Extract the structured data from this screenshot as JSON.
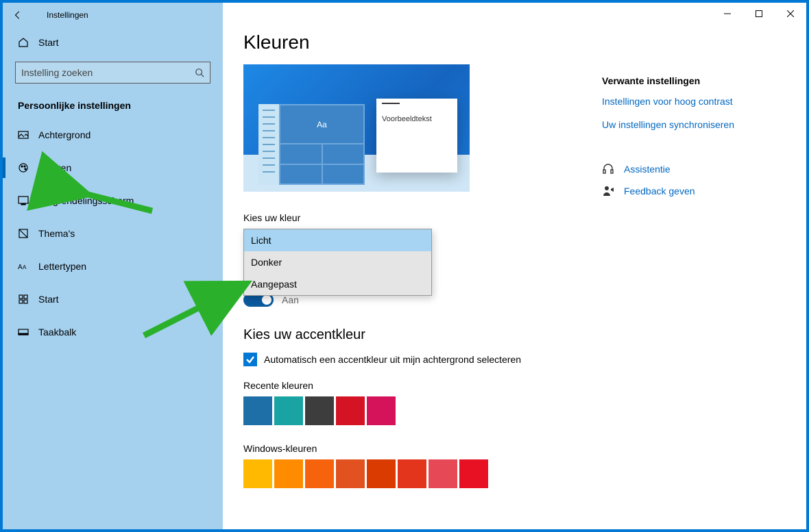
{
  "window": {
    "title": "Instellingen"
  },
  "home": {
    "label": "Start"
  },
  "search": {
    "placeholder": "Instelling zoeken"
  },
  "sidebar": {
    "section_title": "Persoonlijke instellingen",
    "items": [
      {
        "label": "Achtergrond"
      },
      {
        "label": "Kleuren"
      },
      {
        "label": "Vergrendelingsscherm"
      },
      {
        "label": "Thema's"
      },
      {
        "label": "Lettertypen"
      },
      {
        "label": "Start"
      },
      {
        "label": "Taakbalk"
      }
    ]
  },
  "page": {
    "title": "Kleuren",
    "preview_sample_text": "Voorbeeldtekst",
    "preview_tile_text": "Aa",
    "choose_color_label": "Kies uw kleur",
    "color_options": [
      {
        "label": "Licht"
      },
      {
        "label": "Donker"
      },
      {
        "label": "Aangepast"
      }
    ],
    "toggle_label": "Aan",
    "accent_heading": "Kies uw accentkleur",
    "auto_accent_label": "Automatisch een accentkleur uit mijn achtergrond selecteren",
    "recent_colors_label": "Recente kleuren",
    "recent_colors": [
      "#1e6fa8",
      "#1aa3a3",
      "#3d3d3d",
      "#d41324",
      "#d4135a"
    ],
    "windows_colors_label": "Windows-kleuren",
    "windows_colors": [
      "#ffb900",
      "#ff8c00",
      "#f7630c",
      "#e15220",
      "#da3b01",
      "#e3341c",
      "#e74856",
      "#e81123"
    ]
  },
  "right": {
    "heading": "Verwante instellingen",
    "link_contrast": "Instellingen voor hoog contrast",
    "link_sync": "Uw instellingen synchroniseren",
    "assist": "Assistentie",
    "feedback": "Feedback geven"
  }
}
